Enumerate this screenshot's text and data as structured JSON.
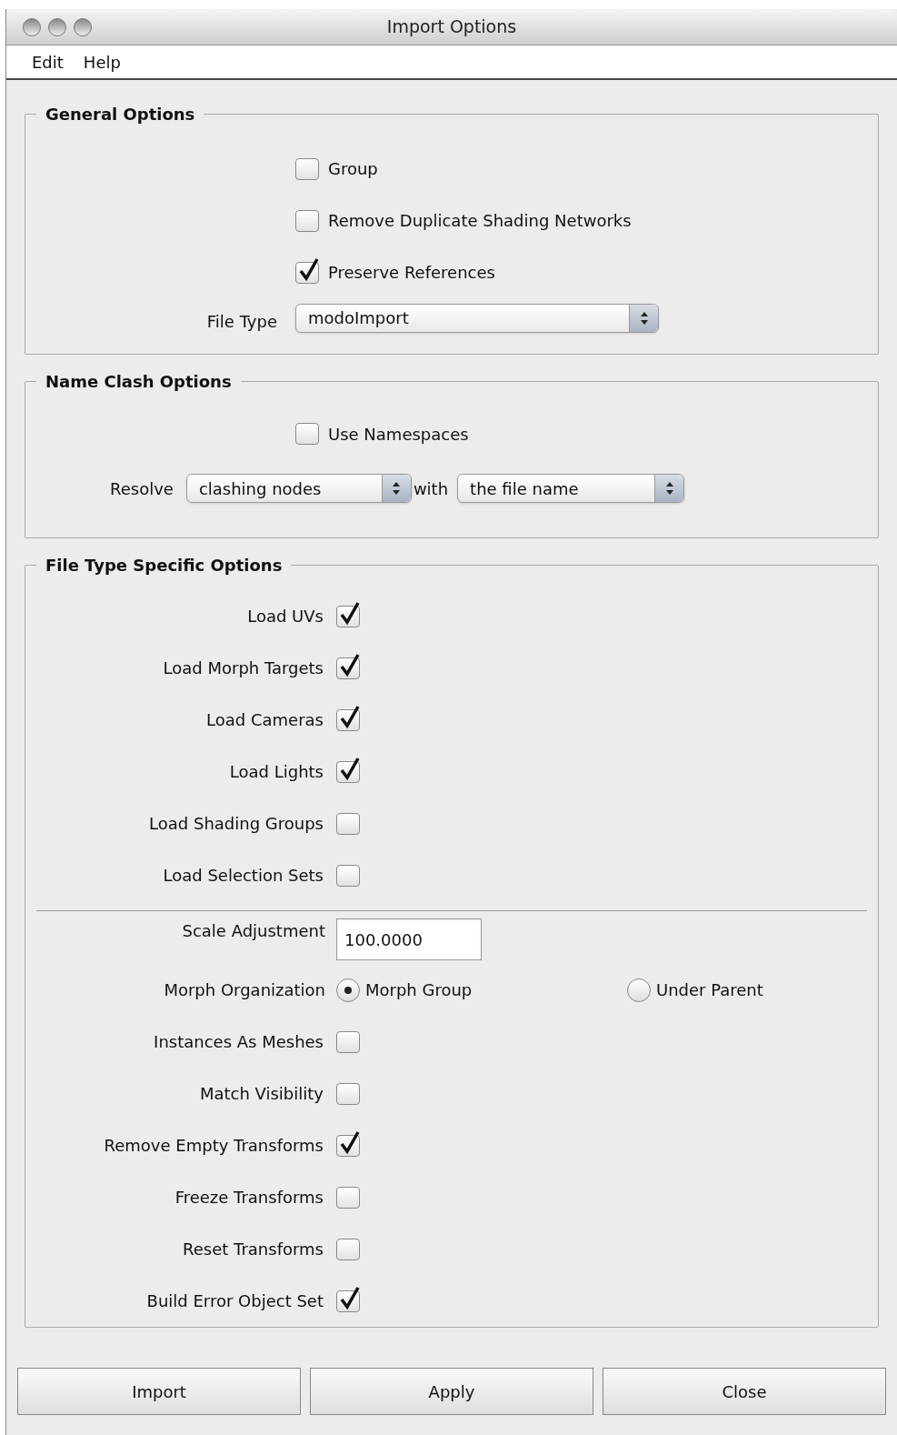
{
  "window": {
    "title": "Import Options"
  },
  "menu": [
    "Edit",
    "Help"
  ],
  "general_options": {
    "title": "General Options",
    "checkboxes": [
      {
        "label": "Group",
        "checked": false
      },
      {
        "label": "Remove Duplicate Shading Networks",
        "checked": false
      },
      {
        "label": "Preserve References",
        "checked": true
      }
    ],
    "file_type": {
      "label": "File Type",
      "value": "modoImport"
    }
  },
  "name_clash_options": {
    "title": "Name Clash Options",
    "use_namespaces": {
      "label": "Use Namespaces",
      "checked": false
    },
    "resolve": {
      "label": "Resolve",
      "value": "clashing nodes"
    },
    "with": {
      "label": "with",
      "value": "the file name"
    }
  },
  "file_type_specific_options": {
    "title": "File Type Specific Options",
    "load_options": [
      {
        "label": "Load UVs",
        "checked": true
      },
      {
        "label": "Load Morph Targets",
        "checked": true
      },
      {
        "label": "Load Cameras",
        "checked": true
      },
      {
        "label": "Load Lights",
        "checked": true
      },
      {
        "label": "Load Shading Groups",
        "checked": false
      },
      {
        "label": "Load Selection Sets",
        "checked": false
      }
    ],
    "scale_adjustment": {
      "label": "Scale Adjustment",
      "value": "100.0000"
    },
    "morph_organization": {
      "label": "Morph Organization",
      "choices": [
        {
          "label": "Morph Group",
          "selected": true
        },
        {
          "label": "Under Parent",
          "selected": false
        }
      ]
    },
    "other_options": [
      {
        "label": "Instances As Meshes",
        "checked": false
      },
      {
        "label": "Match Visibility",
        "checked": false
      },
      {
        "label": "Remove Empty Transforms",
        "checked": true
      },
      {
        "label": "Freeze Transforms",
        "checked": false
      },
      {
        "label": "Reset Transforms",
        "checked": false
      },
      {
        "label": "Build Error Object Set",
        "checked": true
      }
    ]
  },
  "buttons": [
    "Import",
    "Apply",
    "Close"
  ]
}
